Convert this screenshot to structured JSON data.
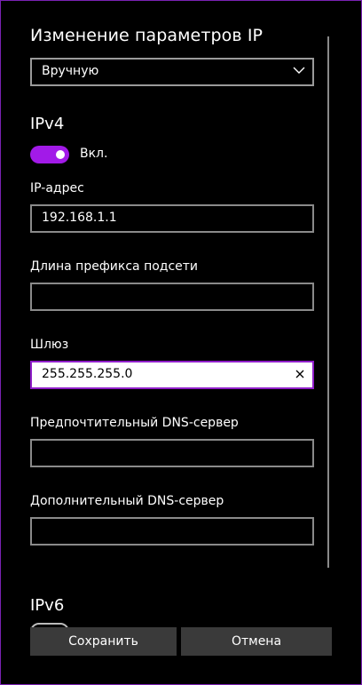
{
  "dialog": {
    "title": "Изменение параметров IP",
    "mode_select": {
      "value": "Вручную",
      "icon": "chevron-down-icon"
    },
    "ipv4": {
      "heading": "IPv4",
      "toggle_label": "Вкл.",
      "toggle_on": true,
      "accent_color": "#a21ae8",
      "fields": {
        "ip_address": {
          "label": "IP-адрес",
          "value": "192.168.1.1"
        },
        "prefix_length": {
          "label": "Длина префикса подсети",
          "value": ""
        },
        "gateway": {
          "label": "Шлюз",
          "value": "255.255.255.0",
          "clear_icon": "close-icon"
        },
        "preferred_dns": {
          "label": "Предпочтительный DNS-сервер",
          "value": ""
        },
        "alternate_dns": {
          "label": "Дополнительный DNS-сервер",
          "value": ""
        }
      }
    },
    "ipv6": {
      "heading": "IPv6"
    },
    "buttons": {
      "save": "Сохранить",
      "cancel": "Отмена"
    }
  }
}
